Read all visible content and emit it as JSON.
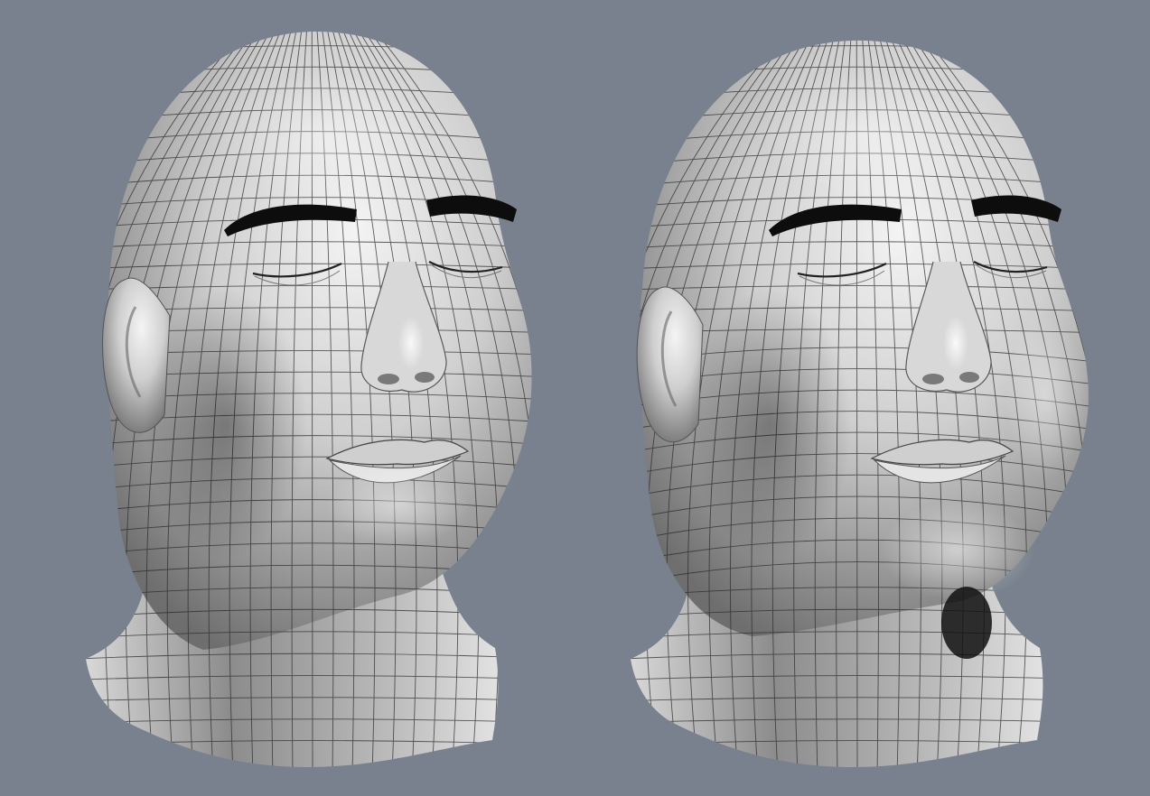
{
  "scene": {
    "background_color": "#78818d",
    "skin_color": "#cfcfcf",
    "wire_color": "#2a2a2a",
    "brow_color": "#0d0d0d",
    "models": [
      {
        "name": "neutral-head",
        "variant": "neutral"
      },
      {
        "name": "swollen-head",
        "variant": "swollen"
      }
    ]
  }
}
